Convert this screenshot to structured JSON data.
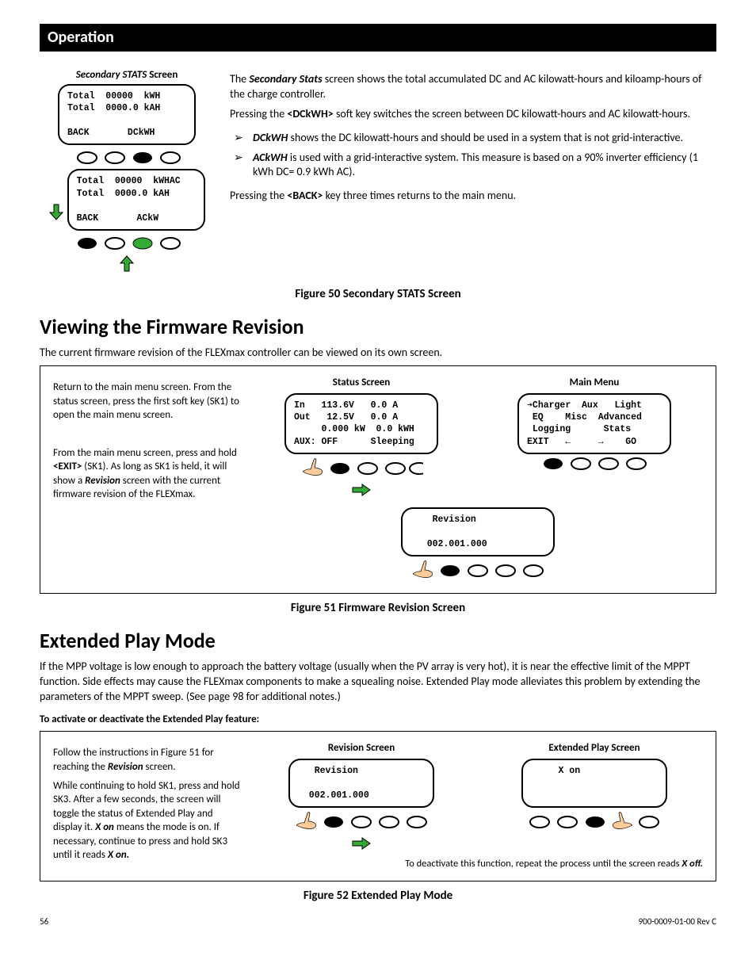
{
  "header": "Operation",
  "s1": {
    "lcd_label_prefix": "Secondary STATS ",
    "lcd_label_suffix": "Screen",
    "lcd1": "Total  00000  kWH\nTotal  0000.0 kAH\n\nBACK       DCkWH",
    "lcd2": "Total  00000  kWHAC\nTotal  0000.0 kAH\n\nBACK       ACkW",
    "p1a": "The ",
    "p1b": "Secondary Stats",
    "p1c": " screen shows the total accumulated DC and AC kilowatt-hours and kiloamp-hours of the charge controller.",
    "p2a": "Pressing the ",
    "p2b": "<DCkWH>",
    "p2c": " soft key switches the screen between DC kilowatt-hours and AC kilowatt-hours.",
    "b1a": "DCkWH",
    "b1b": " shows the DC kilowatt-hours and should be used in a system that is not grid-interactive.",
    "b2a": "ACkWH",
    "b2b": " is used with a grid-interactive system.  This measure is based on a 90% inverter efficiency (1 kWh DC= 0.9 kWh AC).",
    "p3a": "Pressing the ",
    "p3b": "<BACK>",
    "p3c": " key three times returns to the main menu.",
    "fig": "Figure 50       Secondary STATS Screen"
  },
  "h1a": "Viewing the Firmware Revision",
  "p4": "The current firmware revision of the FLEXmax controller can be viewed on its own screen.",
  "s2": {
    "inst1": "Return to the main menu screen.  From the status screen, press the first soft key (SK1) to open the main menu screen.",
    "inst2a": "From the main menu screen, press and hold ",
    "inst2b": "<EXIT>",
    "inst2c": " (SK1).  As long as SK1 is held, it will show a ",
    "inst2d": "Revision",
    "inst2e": " screen with the current firmware revision of the FLEXmax.",
    "status_title": "Status Screen",
    "status_lcd": "In   113.6V   0.0 A\nOut   12.5V   0.0 A\n     0.000 kW  0.0 kWH\nAUX: OFF      Sleeping",
    "main_title": "Main Menu",
    "main_lcd": "➔Charger  Aux   Light\n EQ    Misc  Advanced\n Logging      Stats\nEXIT   ←     →    GO",
    "rev_lcd": "    Revision\n\n   002.001.000",
    "fig": "Figure 51       Firmware Revision Screen"
  },
  "h1b": "Extended Play Mode",
  "p5": "If the MPP voltage is low enough to approach the battery voltage (usually when the PV array is very hot), it is near the effective limit of the MPPT function.  Side effects may cause the FLEXmax components to make a squealing noise.  Extended Play mode alleviates this problem by extending the parameters of the MPPT sweep.  (See page 98 for additional notes.)",
  "s3": {
    "title": "To activate or deactivate the Extended Play feature:",
    "inst1a": "Follow the instructions in Figure 51 for reaching the ",
    "inst1b": "Revision",
    "inst1c": " screen.",
    "inst2a": "While continuing to hold SK1, press and hold SK3.  After a few seconds, the screen will toggle the status of Extended Play and display it.  ",
    "inst2b": "X on",
    "inst2c": " means the mode is on.  If necessary, continue to press  and hold SK3 until it reads ",
    "inst2d": "X on.",
    "rev_title": "Revision Screen",
    "rev_lcd": "   Revision\n\n  002.001.000",
    "ext_title": "Extended Play Screen",
    "ext_lcd": "     X on\n\n ",
    "deact_a": "To deactivate this function, repeat the process until the screen reads ",
    "deact_b": "X off.",
    "fig": "Figure 52       Extended Play Mode"
  },
  "footer": {
    "page": "56",
    "doc": "900-0009-01-00 Rev C"
  }
}
